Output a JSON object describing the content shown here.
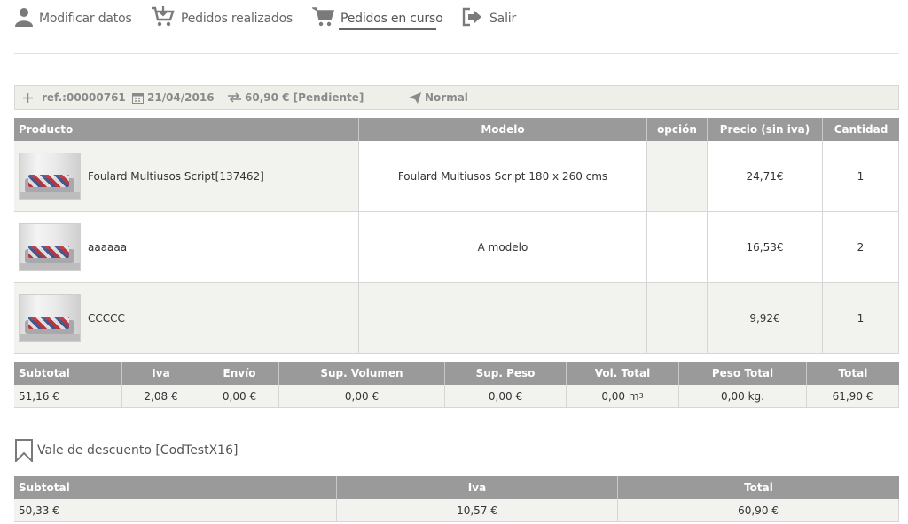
{
  "nav": {
    "items": [
      {
        "label": "Modificar datos",
        "icon": "user-icon"
      },
      {
        "label": "Pedidos realizados",
        "icon": "cart-download-icon"
      },
      {
        "label": "Pedidos en curso",
        "icon": "cart-icon",
        "active": true
      },
      {
        "label": "Salir",
        "icon": "logout-icon"
      }
    ]
  },
  "order": {
    "ref": "ref.:00000761",
    "date": "21/04/2016",
    "amount": "60,90 € [Pendiente]",
    "shipping": "Normal"
  },
  "products": {
    "headers": [
      "Producto",
      "Modelo",
      "opción",
      "Precio (sin iva)",
      "Cantidad"
    ],
    "rows": [
      {
        "name": "Foulard Multiusos Script[137462]",
        "model": "Foulard Multiusos Script 180 x 260 cms",
        "option": "",
        "price": "24,71€",
        "qty": "1"
      },
      {
        "name": "aaaaaa",
        "model": "A modelo",
        "option": "",
        "price": "16,53€",
        "qty": "2"
      },
      {
        "name": "CCCCC",
        "model": "",
        "option": "",
        "price": "9,92€",
        "qty": "1"
      }
    ]
  },
  "totals": {
    "headers": [
      "Subtotal",
      "Iva",
      "Envío",
      "Sup. Volumen",
      "Sup. Peso",
      "Vol. Total",
      "Peso Total",
      "Total"
    ],
    "values": [
      "51,16 €",
      "2,08 €",
      "0,00 €",
      "0,00 €",
      "0,00 €",
      "0,00 m",
      "0,00 kg.",
      "61,90 €"
    ],
    "vol_unit_sup": "3"
  },
  "voucher": {
    "label": "Vale de descuento [CodTestX16]"
  },
  "discount": {
    "headers": [
      "Subtotal",
      "Iva",
      "Total"
    ],
    "values": [
      "50,33 €",
      "10,57 €",
      "60,90 €"
    ]
  },
  "colors": {
    "header_bg": "#9a9a9a",
    "row_bg": "#f2f2ee",
    "bar_bg": "#efefe9"
  }
}
